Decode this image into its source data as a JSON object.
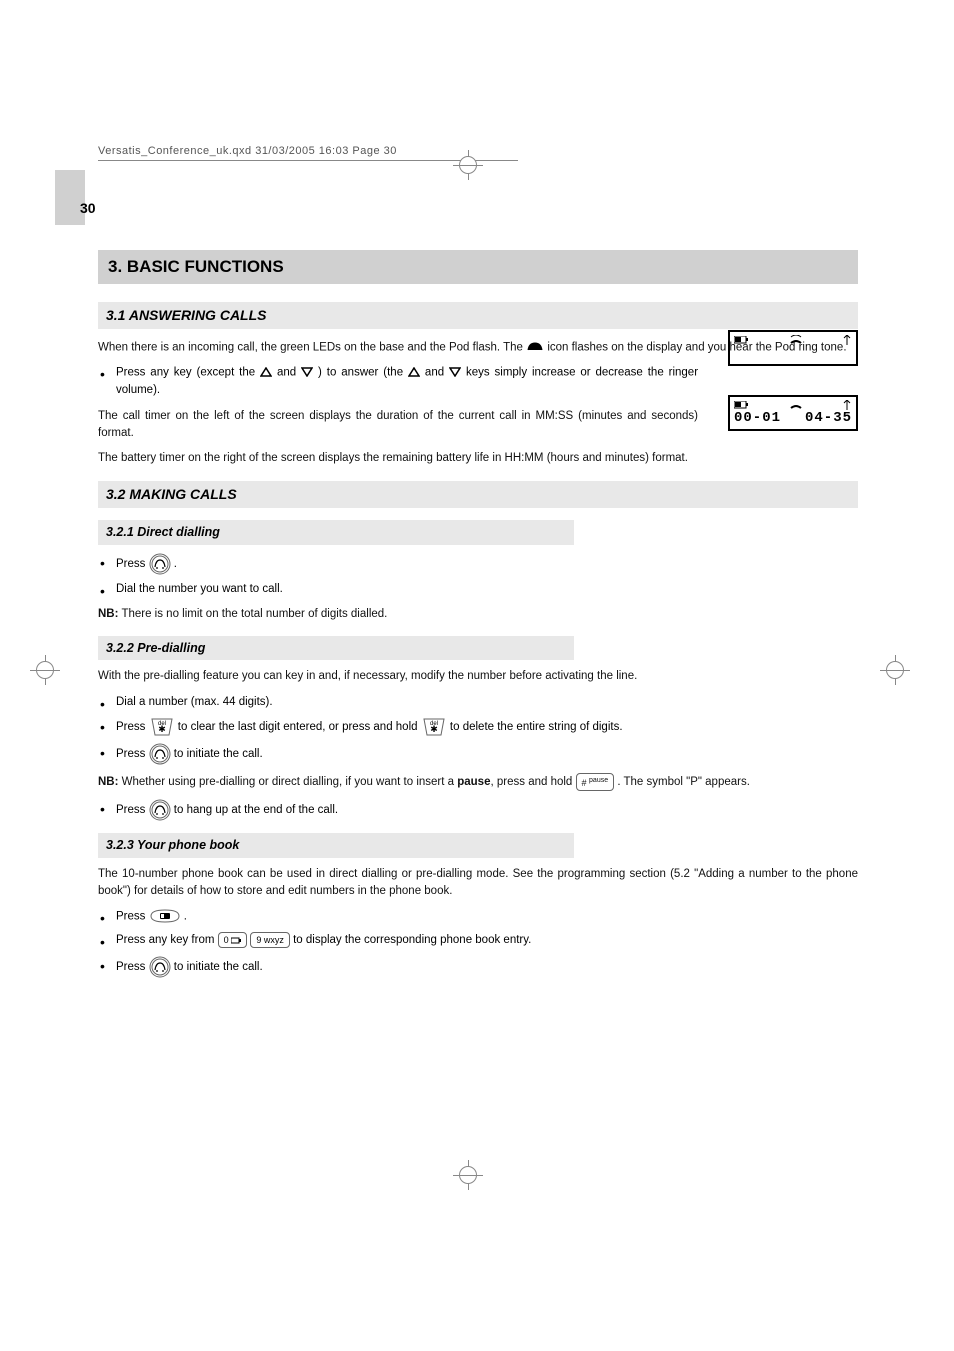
{
  "doc_header": "Versatis_Conference_uk.qxd  31/03/2005  16:03  Page 30",
  "page_number": "30",
  "h1": "3.  BASIC FUNCTIONS",
  "s31": {
    "title": "3.1   ANSWERING CALLS",
    "p1a": "When there is an incoming call, the green LEDs on the base and the Pod flash. The ",
    "p1b": " icon flashes on the display and you hear the Pod ring tone.",
    "b1a": "Press any key (except the ",
    "b1b": " and ",
    "b1c": ") to answer (the ",
    "b1d": " and ",
    "b1e": " keys simply increase or decrease the ringer volume).",
    "p2": "The call timer on the left of the screen displays the duration of the current call in MM:SS (minutes and seconds) format.",
    "p3": "The battery timer on the right of the screen displays the remaining battery life in HH:MM (hours and minutes) format."
  },
  "lcd1": {
    "battery_icon": "true",
    "signal_icon": "true"
  },
  "lcd2": {
    "timer": "00-01",
    "battery_time": "04-35"
  },
  "s32": {
    "title": "3.2   MAKING CALLS",
    "s321": {
      "title": "3.2.1   Direct dialling",
      "b1": "Press ",
      "b1b": " .",
      "b2": "Dial the number you want to call.",
      "nb": "NB:",
      "nbtext": " There is no limit on the total number of digits dialled."
    },
    "s322": {
      "title": "3.2.2   Pre-dialling",
      "p1": "With the pre-dialling feature you can key in and, if necessary, modify the number before activating the line.",
      "b1": "Dial a number (max. 44 digits).",
      "b2a": "Press ",
      "b2b": " to clear the last digit entered, or press and hold ",
      "b2c": " to delete the entire string of digits.",
      "b3a": "Press ",
      "b3b": " to initiate the call.",
      "nb": "NB:",
      "nbtext_a": " Whether using pre-dialling or direct dialling, if you want to insert a ",
      "nbtext_bold": "pause",
      "nbtext_b": ", press and hold ",
      "nbtext_c": ". The symbol \"P\" appears.",
      "b4a": "Press ",
      "b4b": " to hang up at the end of the call."
    },
    "s323": {
      "title": "3.2.3   Your phone book",
      "p1": "The 10-number phone book can be used in direct dialling or pre-dialling mode. See the programming section (5.2 \"Adding a number to the phone book\") for details of how to store and edit numbers in the phone book.",
      "b1a": "Press ",
      "b1b": " .",
      "b2a": "Press any key from ",
      "b2b": " to display the corresponding phone book entry.",
      "b3a": "Press ",
      "b3b": " to initiate the call.",
      "key0": "0",
      "key9": "9 wxyz"
    }
  }
}
